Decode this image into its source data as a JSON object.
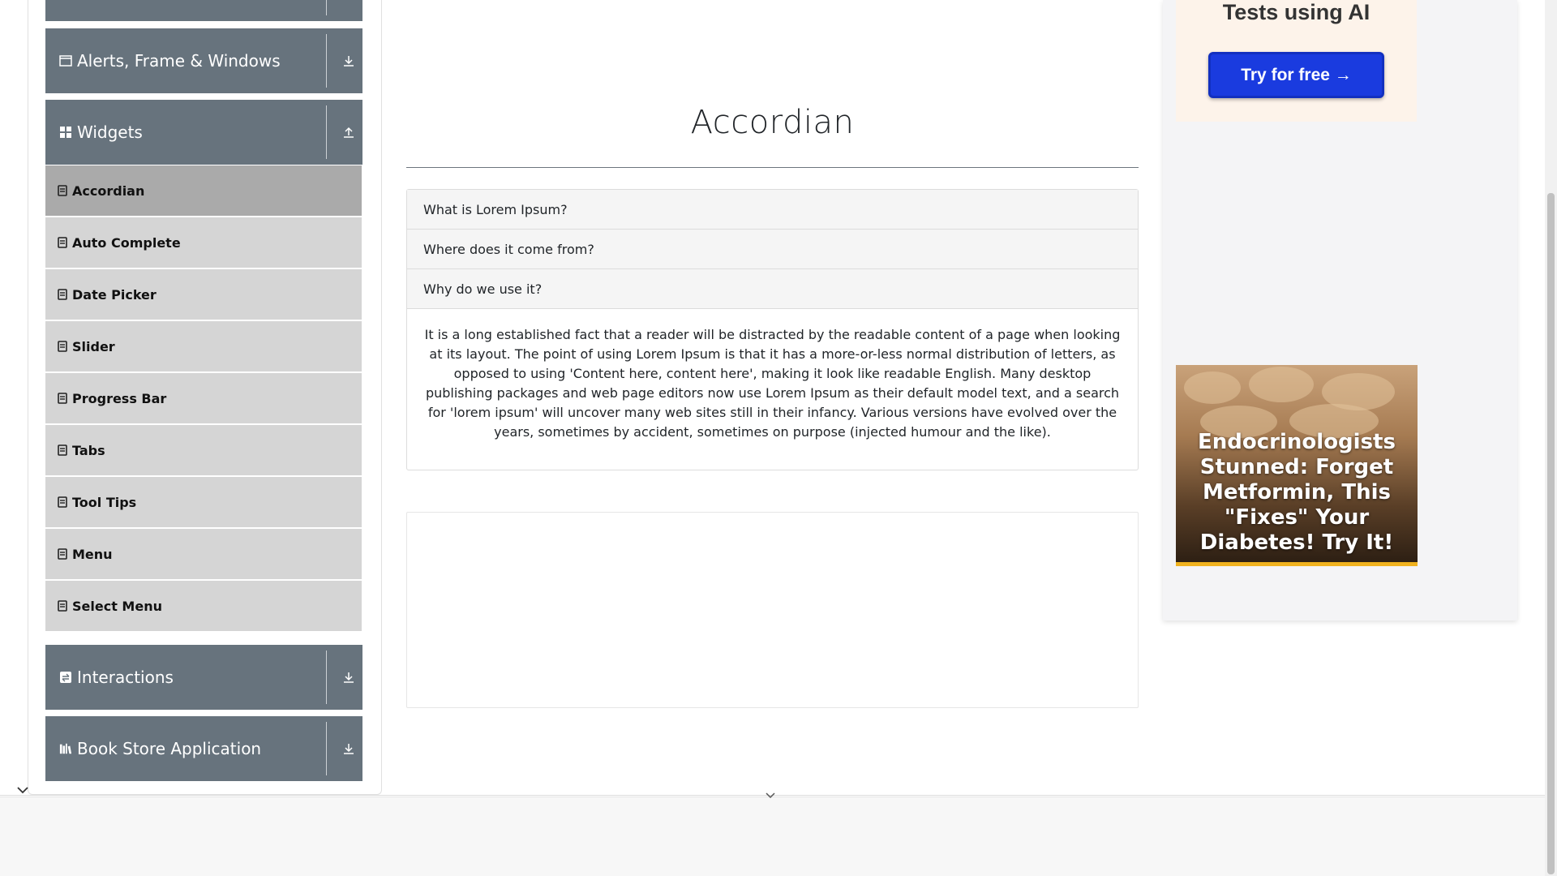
{
  "sidebar": {
    "groups": {
      "alerts": {
        "label": "Alerts, Frame & Windows",
        "icon": "window-icon",
        "arrow": "download-arrow-icon"
      },
      "widgets": {
        "label": "Widgets",
        "icon": "grid-icon",
        "arrow": "upload-arrow-icon"
      },
      "interactions": {
        "label": "Interactions",
        "icon": "interactions-icon",
        "arrow": "download-arrow-icon"
      },
      "bookstore": {
        "label": "Book Store Application",
        "icon": "books-icon",
        "arrow": "download-arrow-icon"
      }
    },
    "items": [
      {
        "label": "Accordian",
        "active": true
      },
      {
        "label": "Auto Complete",
        "active": false
      },
      {
        "label": "Date Picker",
        "active": false
      },
      {
        "label": "Slider",
        "active": false
      },
      {
        "label": "Progress Bar",
        "active": false
      },
      {
        "label": "Tabs",
        "active": false
      },
      {
        "label": "Tool Tips",
        "active": false
      },
      {
        "label": "Menu",
        "active": false
      },
      {
        "label": "Select Menu",
        "active": false
      }
    ]
  },
  "main": {
    "title": "Accordian",
    "accordion": {
      "sections": [
        {
          "header": "What is Lorem Ipsum?"
        },
        {
          "header": "Where does it come from?"
        },
        {
          "header": "Why do we use it?"
        }
      ],
      "open_body": "It is a long established fact that a reader will be distracted by the readable content of a page when looking at its layout. The point of using Lorem Ipsum is that it has a more-or-less normal distribution of letters, as opposed to using 'Content here, content here', making it look like readable English. Many desktop publishing packages and web page editors now use Lorem Ipsum as their default model text, and a search for 'lorem ipsum' will uncover many web sites still in their infancy. Various versions have evolved over the years, sometimes by accident, sometimes on purpose (injected humour and the like)."
    }
  },
  "ads": {
    "top_heading": "Tests using AI",
    "try_button": "Try for free →",
    "card_text": "Endocrinologists Stunned: Forget Metformin, This \"Fixes\" Your Diabetes! Try It!"
  },
  "colors": {
    "group_header": "#67737d",
    "menu_item": "#d5d5d5",
    "menu_item_active": "#aaaaaa",
    "cta_blue": "#1a3bdf"
  }
}
